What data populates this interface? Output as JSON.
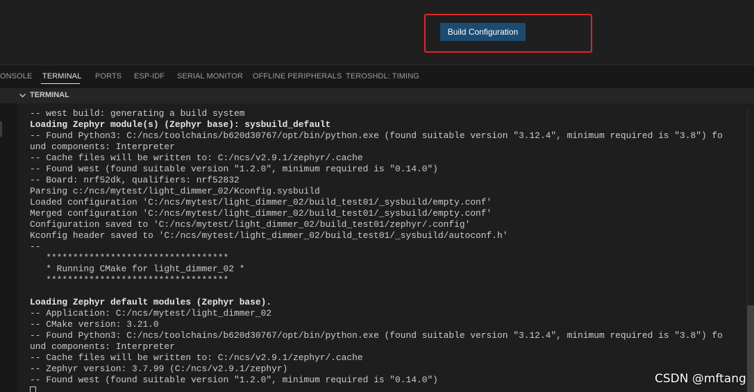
{
  "editor": {
    "build_button_label": "Build Configuration"
  },
  "panel": {
    "tabs": [
      {
        "label": "ONSOLE",
        "active": false
      },
      {
        "label": "TERMINAL",
        "active": true
      },
      {
        "label": "PORTS",
        "active": false
      },
      {
        "label": "ESP-IDF",
        "active": false
      },
      {
        "label": "SERIAL MONITOR",
        "active": false
      },
      {
        "label": "OFFLINE PERIPHERALS",
        "active": false
      },
      {
        "label": "TEROSHDL: TIMING",
        "active": false
      }
    ],
    "section_title": "TERMINAL"
  },
  "terminal": {
    "lines": [
      "-- west build: generating a build system",
      "Loading Zephyr module(s) (Zephyr base): sysbuild_default",
      "-- Found Python3: C:/ncs/toolchains/b620d30767/opt/bin/python.exe (found suitable version \"3.12.4\", minimum required is \"3.8\") fo",
      "und components: Interpreter",
      "-- Cache files will be written to: C:/ncs/v2.9.1/zephyr/.cache",
      "-- Found west (found suitable version \"1.2.0\", minimum required is \"0.14.0\")",
      "-- Board: nrf52dk, qualifiers: nrf52832",
      "Parsing c:/ncs/mytest/light_dimmer_02/Kconfig.sysbuild",
      "Loaded configuration 'C:/ncs/mytest/light_dimmer_02/build_test01/_sysbuild/empty.conf'",
      "Merged configuration 'C:/ncs/mytest/light_dimmer_02/build_test01/_sysbuild/empty.conf'",
      "Configuration saved to 'C:/ncs/mytest/light_dimmer_02/build_test01/zephyr/.config'",
      "Kconfig header saved to 'C:/ncs/mytest/light_dimmer_02/build_test01/_sysbuild/autoconf.h'",
      "--",
      "   **********************************",
      "   * Running CMake for light_dimmer_02 *",
      "   **********************************",
      "",
      "Loading Zephyr default modules (Zephyr base).",
      "-- Application: C:/ncs/mytest/light_dimmer_02",
      "-- CMake version: 3.21.0",
      "-- Found Python3: C:/ncs/toolchains/b620d30767/opt/bin/python.exe (found suitable version \"3.12.4\", minimum required is \"3.8\") fo",
      "und components: Interpreter",
      "-- Cache files will be written to: C:/ncs/v2.9.1/zephyr/.cache",
      "-- Zephyr version: 3.7.99 (C:/ncs/v2.9.1/zephyr)",
      "-- Found west (found suitable version \"1.2.0\", minimum required is \"0.14.0\")"
    ]
  },
  "watermark": "CSDN @mftang",
  "colors": {
    "button_bg": "#1c4b72",
    "highlight_border": "#e0252b",
    "terminal_bg": "#1e1e1e",
    "panel_bg": "#181818"
  }
}
